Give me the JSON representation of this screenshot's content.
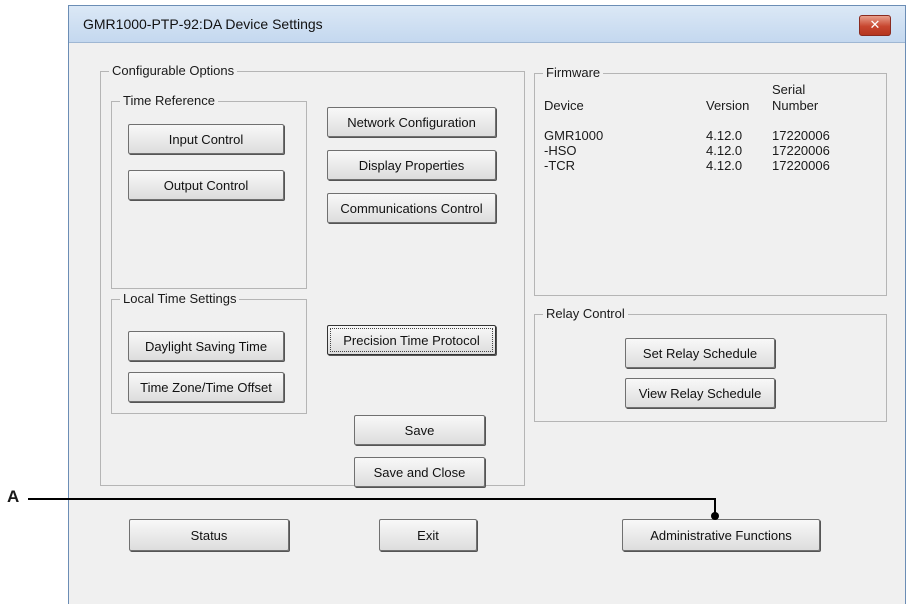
{
  "window": {
    "title": "GMR1000-PTP-92:DA  Device Settings",
    "close_symbol": "✕"
  },
  "configurable": {
    "legend": "Configurable Options",
    "time_reference": {
      "legend": "Time Reference",
      "input_control": "Input Control",
      "output_control": "Output Control"
    },
    "network_configuration": "Network Configuration",
    "display_properties": "Display Properties",
    "communications_control": "Communications Control",
    "local_time": {
      "legend": "Local Time Settings",
      "daylight_saving_time": "Daylight Saving Time",
      "time_zone_offset": "Time Zone/Time Offset"
    },
    "precision_time_protocol": "Precision Time Protocol",
    "save": "Save",
    "save_and_close": "Save and Close"
  },
  "firmware": {
    "legend": "Firmware",
    "headers": {
      "device": "Device",
      "version": "Version",
      "serial_line1": "Serial",
      "serial_line2": "Number"
    },
    "rows": [
      {
        "device": "GMR1000",
        "version": "4.12.0",
        "serial": "17220006"
      },
      {
        "device": "-HSO",
        "version": "4.12.0",
        "serial": "17220006"
      },
      {
        "device": "-TCR",
        "version": "4.12.0",
        "serial": "17220006"
      }
    ]
  },
  "relay": {
    "legend": "Relay Control",
    "set_schedule": "Set Relay Schedule",
    "view_schedule": "View Relay Schedule"
  },
  "bottom": {
    "status": "Status",
    "exit": "Exit",
    "admin": "Administrative Functions"
  },
  "callout": {
    "label": "A"
  }
}
